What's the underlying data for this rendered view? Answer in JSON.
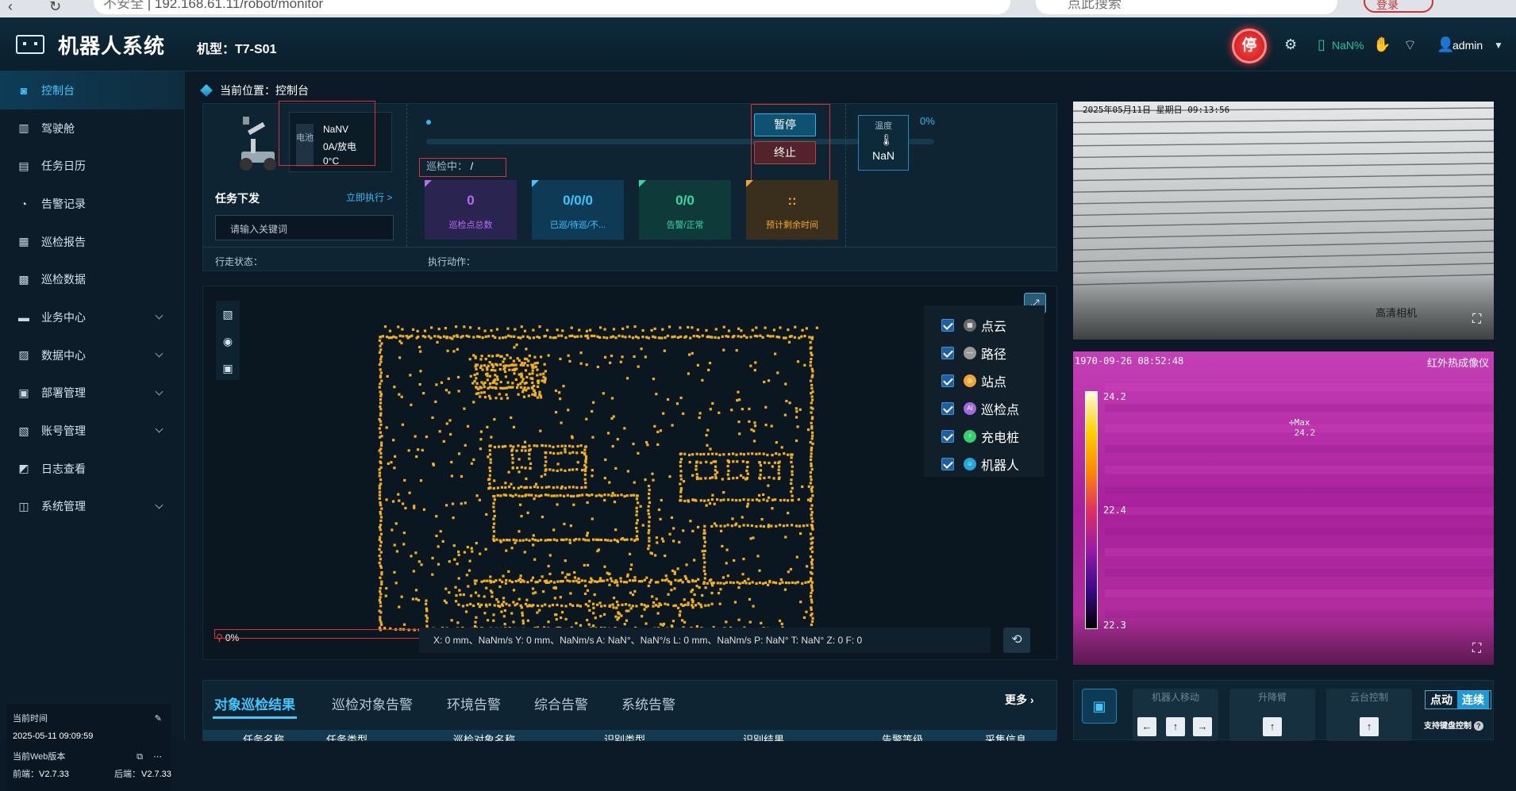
{
  "browser": {
    "security": "不安全",
    "url": "192.168.61.11/robot/monitor",
    "search_placeholder": "点此搜索",
    "login": "登录"
  },
  "header": {
    "app_title": "机器人系统",
    "model_label": "机型：T7-S01",
    "stop_label": "停",
    "battery_value": "NaN%",
    "user": "admin"
  },
  "sidebar": {
    "items": [
      {
        "label": "控制台",
        "icon": "dashboard-icon",
        "expandable": false,
        "active": true
      },
      {
        "label": "驾驶舱",
        "icon": "cockpit-icon",
        "expandable": false
      },
      {
        "label": "任务日历",
        "icon": "calendar-icon",
        "expandable": false
      },
      {
        "label": "告警记录",
        "icon": "alarm-icon",
        "expandable": false
      },
      {
        "label": "巡检报告",
        "icon": "report-icon",
        "expandable": false
      },
      {
        "label": "巡检数据",
        "icon": "data-icon",
        "expandable": false
      },
      {
        "label": "业务中心",
        "icon": "folder-icon",
        "expandable": true
      },
      {
        "label": "数据中心",
        "icon": "chart-icon",
        "expandable": true
      },
      {
        "label": "部署管理",
        "icon": "deploy-icon",
        "expandable": true
      },
      {
        "label": "账号管理",
        "icon": "account-icon",
        "expandable": true
      },
      {
        "label": "日志查看",
        "icon": "log-icon",
        "expandable": false
      },
      {
        "label": "系统管理",
        "icon": "settings-icon",
        "expandable": true
      }
    ],
    "footer": {
      "time_label": "当前时间",
      "time_value": "2025-05-11 09:09:59",
      "version_label": "当前Web版本",
      "frontend_label": "前端：",
      "frontend_version": "V2.7.33",
      "backend_label": "后端：",
      "backend_version": "V2.7.33"
    }
  },
  "breadcrumb": "当前位置：控制台",
  "status": {
    "battery_label": "电池",
    "voltage": "NaNV",
    "current": "0A/放电",
    "temperature": "0°C",
    "progress_pct": "0%",
    "progress_value": 0,
    "patrol_label": "巡检中：",
    "patrol_value": "/",
    "pause_label": "暂停",
    "end_label": "终止",
    "env_temp_label": "温度",
    "env_temp_value": "NaN",
    "task_title": "任务下发",
    "task_exec": "立即执行 >",
    "task_placeholder": "请输入关键词",
    "walk_state_label": "行走状态：",
    "action_label": "执行动作：",
    "cards": [
      {
        "value": "0",
        "label": "巡检点总数",
        "color": "#b46cf0",
        "bg": "#2a2550"
      },
      {
        "value": "0/0/0",
        "label": "已巡/待巡/不...",
        "color": "#3ec6ff",
        "bg": "#0f3a55"
      },
      {
        "value": "0/0",
        "label": "告警/正常",
        "color": "#35d8a8",
        "bg": "#0f3a3a"
      },
      {
        "value": "::",
        "label": "预计剩余时间",
        "color": "#f0a530",
        "bg": "#3a2f1c"
      }
    ]
  },
  "map": {
    "layers": [
      {
        "label": "点云",
        "color": "#6a6a6a",
        "glyph": "▦"
      },
      {
        "label": "路径",
        "color": "#9a9a9a",
        "glyph": "—"
      },
      {
        "label": "站点",
        "color": "#f0a530",
        "glyph": "◎"
      },
      {
        "label": "巡检点",
        "color": "#a06ae0",
        "glyph": "AI"
      },
      {
        "label": "充电桩",
        "color": "#35d070",
        "glyph": "⚡"
      },
      {
        "label": "机器人",
        "color": "#22a8d8",
        "glyph": "☺"
      }
    ],
    "progress_pct": "0%",
    "footer_text": "X: 0 mm、NaNm/s    Y: 0 mm、NaNm/s    A: NaN°、NaN°/s    L: 0 mm、NaNm/s    P: NaN°    T: NaN°    Z: 0    F: 0"
  },
  "alerts": {
    "tabs": [
      "对象巡检结果",
      "巡检对象告警",
      "环境告警",
      "综合告警",
      "系统告警"
    ],
    "more": "更多",
    "columns": [
      "任务名称",
      "任务类型",
      "巡检对象名称",
      "识别类型",
      "识别结果",
      "告警等级",
      "采集信息"
    ]
  },
  "cameras": {
    "visible_time": "2025年05月11日 星期日 09:13:56",
    "visible_label": "高清相机",
    "ir_time": "1970-09-26 08:52:48",
    "ir_label": "红外热成像仪",
    "ir_scale": [
      "24.2",
      "22.4",
      "22.3"
    ],
    "ir_max_label": "Max",
    "ir_max_value": "24.2"
  },
  "controls": {
    "move_label": "机器人移动",
    "lift_label": "升降臂",
    "ptz_label": "云台控制",
    "mode_off": "点动",
    "mode_on": "连续",
    "kb_hint": "支持键盘控制"
  }
}
